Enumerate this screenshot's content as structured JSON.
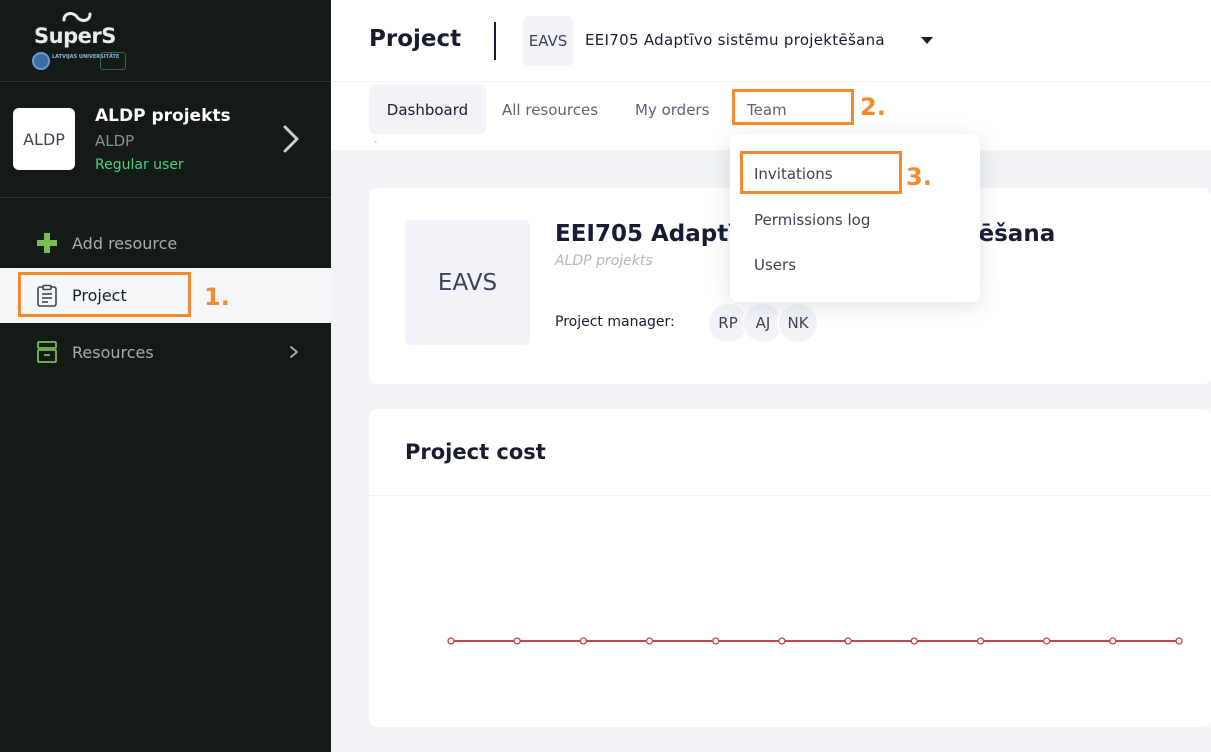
{
  "brand": {
    "name": "SuperS",
    "university_text": "LATVIJAS UNIVERSITĀTE"
  },
  "sidebar": {
    "project": {
      "avatar_text": "ALDP",
      "name": "ALDP projekts",
      "code": "ALDP",
      "role": "Regular user"
    },
    "items": [
      {
        "label": "Add resource",
        "icon": "plus-icon"
      },
      {
        "label": "Project",
        "icon": "clipboard-icon"
      },
      {
        "label": "Resources",
        "icon": "archive-box-icon"
      }
    ]
  },
  "header": {
    "title": "Project",
    "project_code": "EAVS",
    "project_name": "EEI705 Adaptīvo sistēmu projektēšana"
  },
  "tabs": [
    {
      "label": "Dashboard"
    },
    {
      "label": "All resources"
    },
    {
      "label": "My orders"
    },
    {
      "label": "Team"
    }
  ],
  "team_menu": {
    "items": [
      {
        "label": "Invitations"
      },
      {
        "label": "Permissions log"
      },
      {
        "label": "Users"
      }
    ]
  },
  "project_card": {
    "avatar_text": "EAVS",
    "title": "EEI705 Adaptīvo sistēmu projektēšana",
    "subtitle": "ALDP projekts",
    "manager_label": "Project manager:",
    "managers": [
      "RP",
      "AJ",
      "NK"
    ]
  },
  "cost_card": {
    "title": "Project cost"
  },
  "chart_data": {
    "type": "line",
    "series": [
      {
        "values": [
          0,
          0,
          0,
          0,
          0,
          0,
          0,
          0,
          0,
          0,
          0,
          0
        ],
        "color": "#c8454a"
      }
    ]
  },
  "annotations": {
    "step1": "1.",
    "step2": "2.",
    "step3": "3.",
    "color": "#f28a30"
  }
}
